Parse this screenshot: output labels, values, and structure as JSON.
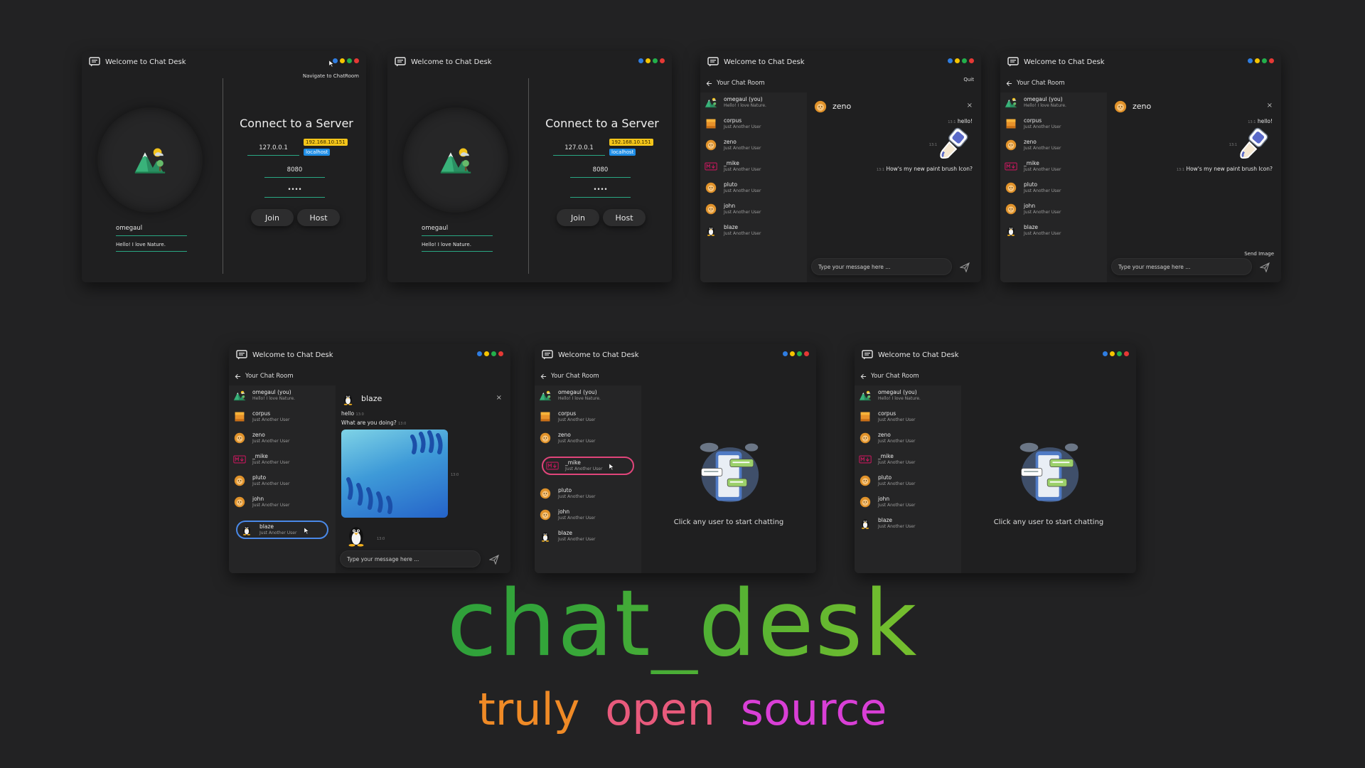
{
  "app": {
    "title": "Welcome to Chat Desk"
  },
  "colors": {
    "dot_blue": "#2f7de1",
    "dot_yellow": "#f5c400",
    "dot_green": "#22b04b",
    "dot_red": "#e53935",
    "accent": "#29a783"
  },
  "login": {
    "tooltip": "Navigate to ChatRoom",
    "username": "omegaul",
    "status": "Hello! I love Nature.",
    "connect_title": "Connect to a Server",
    "host": "127.0.0.1",
    "port": "8080",
    "password": "••••",
    "chip_ip": "192.168.10.151",
    "chip_localhost": "localhost",
    "join_label": "Join",
    "host_label": "Host"
  },
  "room": {
    "header": "Your Chat Room",
    "quit": "Quit",
    "send_image_tip": "Send Image",
    "placeholder": "Type your message here ...",
    "empty_text": "Click any user to start chatting"
  },
  "users": [
    {
      "name": "omegaul (you)",
      "status": "Hello! I love Nature.",
      "icon": "mountain-icon"
    },
    {
      "name": "corpus",
      "status": "Just Another User",
      "icon": "orange-square-icon"
    },
    {
      "name": "zeno",
      "status": "Just Another User",
      "icon": "lion-icon"
    },
    {
      "name": "_mike",
      "status": "Just Another User",
      "icon": "markdown-icon"
    },
    {
      "name": "pluto",
      "status": "Just Another User",
      "icon": "lion-icon"
    },
    {
      "name": "john",
      "status": "Just Another User",
      "icon": "lion-icon"
    },
    {
      "name": "blaze",
      "status": "Just Another User",
      "icon": "penguin-icon"
    }
  ],
  "chat_zeno": {
    "name": "zeno",
    "messages": [
      {
        "text": "hello!",
        "time": "13:1"
      },
      {
        "text": "How's my new paint brush Icon?",
        "time": "13:1"
      }
    ]
  },
  "chat_blaze": {
    "name": "blaze",
    "messages": [
      {
        "text": "hello",
        "time": "13:0"
      },
      {
        "text": "What are you doing?",
        "time": "13:0"
      }
    ],
    "image_time": "13:0",
    "sticker_time": "13:0"
  },
  "brand": {
    "name": "chat_desk",
    "tag1": "truly",
    "tag2": "open",
    "tag3": "source"
  }
}
